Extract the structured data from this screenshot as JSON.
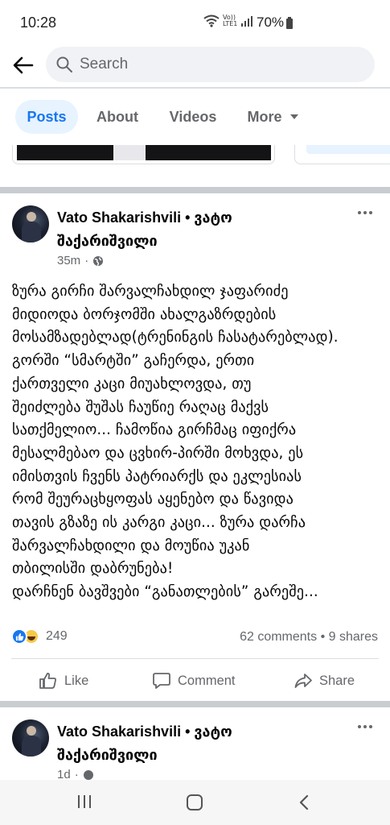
{
  "status_bar": {
    "time": "10:28",
    "volte_line1": "Vo))",
    "volte_line2": "LTE1",
    "battery": "70%"
  },
  "search": {
    "placeholder": "Search"
  },
  "tabs": [
    {
      "label": "Posts",
      "active": true
    },
    {
      "label": "About"
    },
    {
      "label": "Videos"
    },
    {
      "label": "More"
    }
  ],
  "posts": [
    {
      "author": "Vato Shakarishvili • ვატო შაქარიშვილი",
      "time": "35m",
      "lines": [
        "ზურა გირჩი შარვალჩახდილ ჯაფარიძე",
        "მიდიოდა ბორჯომში ახალგაზრდების",
        "მოსამზადებლად(ტრენინგის ჩასატარებლად).",
        "გორში “სმარტში” გაჩერდა, ერთი",
        "ქართველი კაცი მიუახლოვდა, თუ",
        "შეიძლება შუშას ჩაუწიე რაღაც მაქვს",
        "სათქმელიო... ჩამოწია გირჩმაც იფიქრა",
        "მესალმებაო და ცვხირ-პირში მოხვდა, ეს",
        "იმისთვის ჩვენს პატრიარქს და ეკლესიას",
        "რომ შეურაცხყოფას აყენებო და წავიდა",
        "თავის გზაზე ის კარგი კაცი... ზურა დარჩა",
        "შარვალჩახდილი და მოუწია უკან",
        "თბილისში დაბრუნება!",
        "დარჩნენ ბავშვები “განათლების” გარეშე..."
      ],
      "reactions_count": "249",
      "comments": "62 comments",
      "shares": "9 shares",
      "actions": {
        "like": "Like",
        "comment": "Comment",
        "share": "Share"
      }
    },
    {
      "author": "Vato Shakarishvili • ვატო შაქარიშვილი",
      "time": "1d"
    }
  ],
  "colors": {
    "accent": "#1877f2",
    "secondary_text": "#65676b",
    "separator": "#c9ccd1",
    "active_tab_bg": "#e7f3ff"
  },
  "icons": {
    "back": "arrow-left-icon",
    "search": "search-icon",
    "globe": "globe-icon",
    "more": "more-horizontal-icon",
    "like": "thumbs-up-icon",
    "comment": "comment-icon",
    "share": "share-icon"
  }
}
